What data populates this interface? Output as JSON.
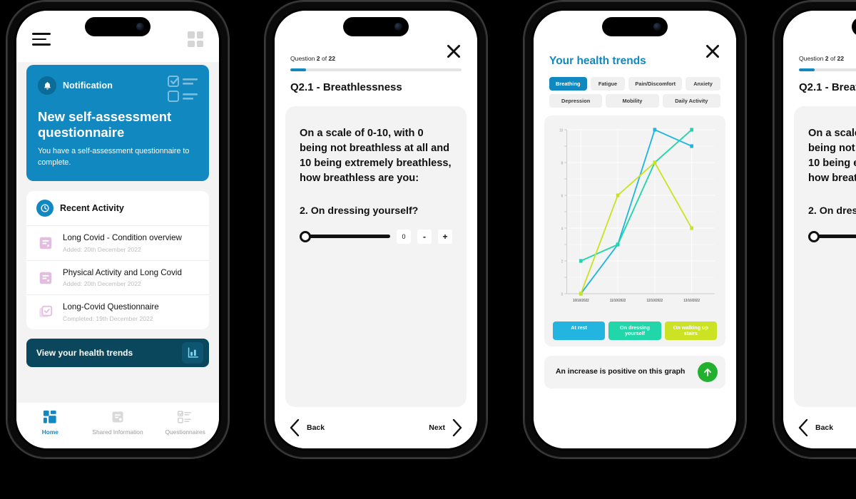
{
  "brand": {
    "blue": "#1288c0",
    "dark_teal": "#0b475c",
    "green": "#22b02e"
  },
  "phone1": {
    "header": {
      "menu_icon": "hamburger-menu-icon",
      "grid_icon": "grid-icon"
    },
    "notification": {
      "label": "Notification",
      "title": "New self-assessment questionnaire",
      "subtitle": "You have a self-assessment questionnaire to complete.",
      "bell_icon": "bell-icon"
    },
    "recent_activity": {
      "title": "Recent Activity",
      "clock_icon": "clock-history-icon",
      "items": [
        {
          "title": "Long Covid - Condition overview",
          "meta": "Added: 20th December 2022",
          "icon": "document-icon"
        },
        {
          "title": "Physical Activity and Long Covid",
          "meta": "Added: 20th December 2022",
          "icon": "document-icon"
        },
        {
          "title": "Long-Covid Questionnaire",
          "meta": "Completed: 19th December 2022",
          "icon": "checklist-icon"
        }
      ]
    },
    "trends_button": {
      "label": "View your health trends",
      "icon": "bar-chart-icon"
    },
    "tabbar": [
      {
        "label": "Home",
        "icon": "home-grid-icon",
        "active": true
      },
      {
        "label": "Shared Information",
        "icon": "shared-document-icon",
        "active": false
      },
      {
        "label": "Questionnaires",
        "icon": "questionnaire-list-icon",
        "active": false
      }
    ]
  },
  "phone2": {
    "close_icon": "close-icon",
    "counter_prefix": "Question ",
    "counter_current": "2",
    "counter_middle": " of ",
    "counter_total": "22",
    "progress_percent": 9,
    "heading": "Q2.1 - Breathlessness",
    "question_body": "On a scale of 0-10, with 0 being not breathless at all and 10 being extremely breathless, how breathless are you:",
    "sub_question": "2. On dressing yourself?",
    "slider": {
      "value": "0",
      "min": 0,
      "max": 10,
      "minus_label": "-",
      "plus_label": "+"
    },
    "nav": {
      "back_label": "Back",
      "next_label": "Next",
      "back_icon": "chevron-left-icon",
      "next_icon": "chevron-right-icon"
    }
  },
  "phone3": {
    "close_icon": "close-icon",
    "title": "Your health trends",
    "chips": [
      {
        "label": "Breathing",
        "active": true
      },
      {
        "label": "Fatigue",
        "active": false
      },
      {
        "label": "Pain/Discomfort",
        "active": false
      },
      {
        "label": "Anxiety",
        "active": false
      },
      {
        "label": "Depression",
        "active": false
      },
      {
        "label": "Mobility",
        "active": false
      },
      {
        "label": "Daily Activity",
        "active": false
      }
    ],
    "note": {
      "text": "An increase is positive on this graph",
      "icon": "arrow-up-circle-icon"
    }
  },
  "chart_data": {
    "type": "line",
    "title": "Your health trends",
    "xlabel": "",
    "ylabel": "",
    "x": [
      "10/10/2022",
      "11/10/2022",
      "12/10/2022",
      "13/10/2022"
    ],
    "ylim": [
      0,
      10
    ],
    "yticks": [
      0,
      2,
      4,
      6,
      8,
      10
    ],
    "grid": true,
    "legend_position": "bottom",
    "series": [
      {
        "name": "At rest",
        "color": "#23b5e0",
        "values": [
          0,
          3,
          10,
          9
        ]
      },
      {
        "name": "On dressing yourself",
        "color": "#21d6a8",
        "values": [
          2,
          3,
          8,
          10
        ]
      },
      {
        "name": "On walking up stairs",
        "color": "#cbe324",
        "values": [
          0,
          6,
          8,
          4
        ]
      }
    ]
  }
}
